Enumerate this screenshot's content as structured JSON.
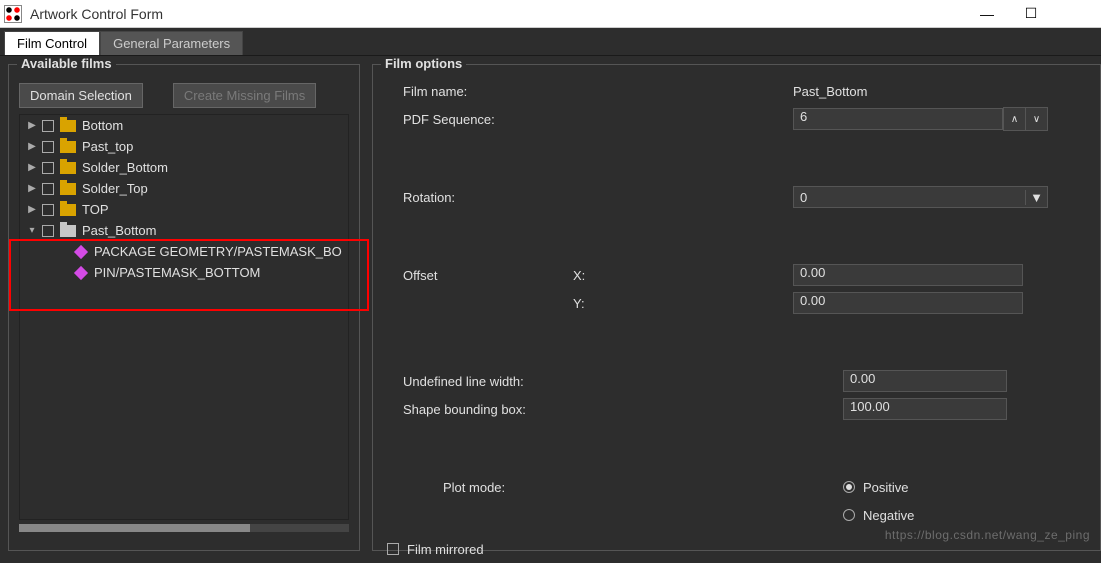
{
  "window": {
    "title": "Artwork Control Form"
  },
  "tabs": {
    "film_control": "Film Control",
    "general_parameters": "General Parameters"
  },
  "left": {
    "legend": "Available films",
    "btn_domain": "Domain Selection",
    "btn_create": "Create Missing Films",
    "items": {
      "bottom": "Bottom",
      "past_top": "Past_top",
      "solder_bottom": "Solder_Bottom",
      "solder_top": "Solder_Top",
      "top": "TOP",
      "past_bottom": "Past_Bottom",
      "pb_child1": "PACKAGE GEOMETRY/PASTEMASK_BO",
      "pb_child2": "PIN/PASTEMASK_BOTTOM"
    }
  },
  "right": {
    "legend": "Film options",
    "labels": {
      "film_name": "Film name:",
      "pdf_sequence": "PDF Sequence:",
      "rotation": "Rotation:",
      "offset": "Offset",
      "x": "X:",
      "y": "Y:",
      "undef": "Undefined line width:",
      "shape": "Shape bounding box:",
      "plot_mode": "Plot mode:",
      "positive": "Positive",
      "negative": "Negative",
      "mirrored": "Film mirrored"
    },
    "values": {
      "film_name": "Past_Bottom",
      "pdf_sequence": "6",
      "rotation": "0",
      "offset_x": "0.00",
      "offset_y": "0.00",
      "undef": "0.00",
      "shape": "100.00"
    }
  },
  "watermark": "https://blog.csdn.net/wang_ze_ping"
}
